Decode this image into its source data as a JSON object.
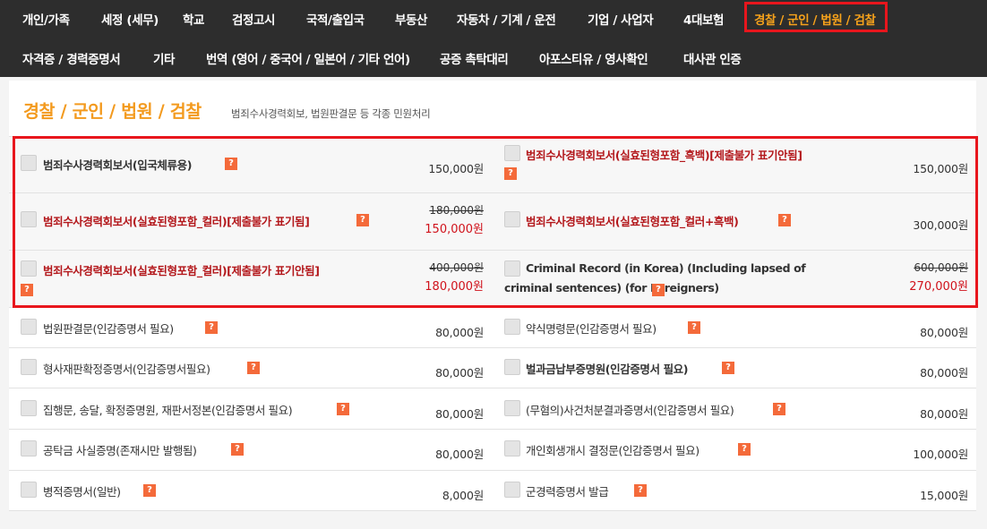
{
  "nav": {
    "row1": [
      "개인/가족",
      "세정 (세무)",
      "학교",
      "검정고시",
      "국적/출입국",
      "부동산",
      "자동차 / 기계 / 운전",
      "기업 / 사업자",
      "4대보험",
      "경찰 / 군인 / 법원 / 검찰"
    ],
    "row2": [
      "자격증 / 경력증명서",
      "기타",
      "번역 (영어 / 중국어 / 일본어 / 기타 언어)",
      "공증 촉탁대리",
      "아포스티유 / 영사확인",
      "대사관 인증"
    ]
  },
  "section": {
    "title": "경찰 / 군인 / 법원 / 검찰",
    "subtitle": "범죄수사경력회보, 법원판결문 등 각종 민원처리"
  },
  "help_glyph": "?",
  "items": [
    {
      "label": "범죄수사경력회보서(입국체류용)",
      "price": "150,000원"
    },
    {
      "label": "범죄수사경력회보서(실효된형포함_흑백)[제출불가 표기안됨]",
      "price": "150,000원"
    },
    {
      "label": "범죄수사경력회보서(실효된형포함_컬러)[제출불가 표기됨]",
      "old_price": "180,000원",
      "price": "150,000원"
    },
    {
      "label": "범죄수사경력회보서(실효된형포함_컬러+흑백)",
      "price": "300,000원"
    },
    {
      "label": "범죄수사경력회보서(실효된형포함_컬러)[제출불가 표기안됨]",
      "old_price": "400,000원",
      "price": "180,000원"
    },
    {
      "label": "Criminal Record (in Korea) (Including lapsed of criminal sentences) (for Foreigners)",
      "old_price": "600,000원",
      "price": "270,000원"
    },
    {
      "label": "법원판결문(인감증명서 필요)",
      "price": "80,000원"
    },
    {
      "label": "약식명령문(인감증명서 필요)",
      "price": "80,000원"
    },
    {
      "label": "형사재판확정증명서(인감증명서필요)",
      "price": "80,000원"
    },
    {
      "label": "벌과금납부증명원(인감증명서 필요)",
      "price": "80,000원"
    },
    {
      "label": "집행문, 송달, 확정증명원, 재판서정본(인감증명서 필요)",
      "price": "80,000원"
    },
    {
      "label": "(무혐의)사건처분결과증명서(인감증명서 필요)",
      "price": "80,000원"
    },
    {
      "label": "공탁금 사실증명(존재시만 발행됨)",
      "price": "80,000원"
    },
    {
      "label": "개인회생개시 결정문(인감증명서 필요)",
      "price": "100,000원"
    },
    {
      "label": "병적증명서(일반)",
      "price": "8,000원"
    },
    {
      "label": "군경력증명서 발급",
      "price": "15,000원"
    }
  ],
  "colors": {
    "nav_bg": "#2d2d2d",
    "accent": "#f39a1e",
    "highlight": "#e8161d",
    "sale": "#d0121b",
    "label_red": "#b3171b",
    "help": "#f46a3a"
  }
}
